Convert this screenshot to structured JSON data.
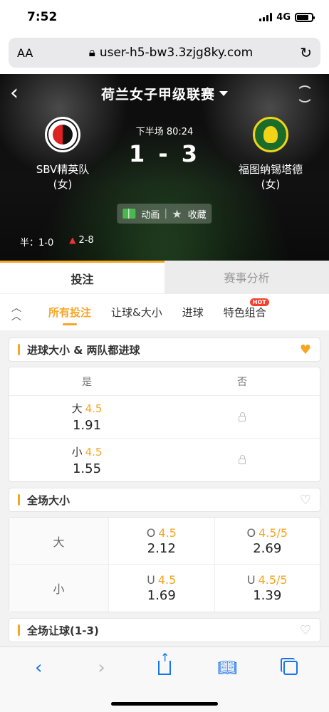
{
  "status_bar": {
    "time": "7:52",
    "network": "4G"
  },
  "browser": {
    "aa_label": "AA",
    "url": "user-h5-bw3.3zjg8ky.com",
    "lock_icon": "lock-icon",
    "reload_icon": "reload-icon"
  },
  "header": {
    "league": "荷兰女子甲级联赛",
    "home_team": {
      "name_line1": "SBV精英队",
      "name_line2": "(女)"
    },
    "away_team": {
      "name_line1": "福图纳锡塔德",
      "name_line2": "(女)"
    },
    "match_time": "下半场  80:24",
    "score": "1 - 3",
    "animation_label": "动画",
    "favorite_label": "收藏",
    "half_score": "半：1-0",
    "corners": "2-8"
  },
  "main_tabs": [
    "投注",
    "赛事分析"
  ],
  "sub_tabs": [
    "所有投注",
    "让球&大小",
    "进球",
    "特色组合"
  ],
  "hot_badge": "HOT",
  "sections": {
    "btts": {
      "title": "进球大小 & 两队都进球",
      "col_yes": "是",
      "col_no": "否",
      "rows": [
        {
          "label": "大",
          "line": "4.5",
          "odds": "1.91"
        },
        {
          "label": "小",
          "line": "4.5",
          "odds": "1.55"
        }
      ]
    },
    "total": {
      "title": "全场大小",
      "rows": [
        {
          "label": "大",
          "c1_prefix": "O",
          "c1_line": "4.5",
          "c1_odds": "2.12",
          "c2_prefix": "O",
          "c2_line": "4.5/5",
          "c2_odds": "2.69"
        },
        {
          "label": "小",
          "c1_prefix": "U",
          "c1_line": "4.5",
          "c1_odds": "1.69",
          "c2_prefix": "U",
          "c2_line": "4.5/5",
          "c2_odds": "1.39"
        }
      ]
    },
    "handicap": {
      "title": "全场让球(1-3)"
    }
  },
  "colors": {
    "accent": "#f5a623",
    "link_blue": "#1a73e8",
    "hot": "#f4432d"
  }
}
